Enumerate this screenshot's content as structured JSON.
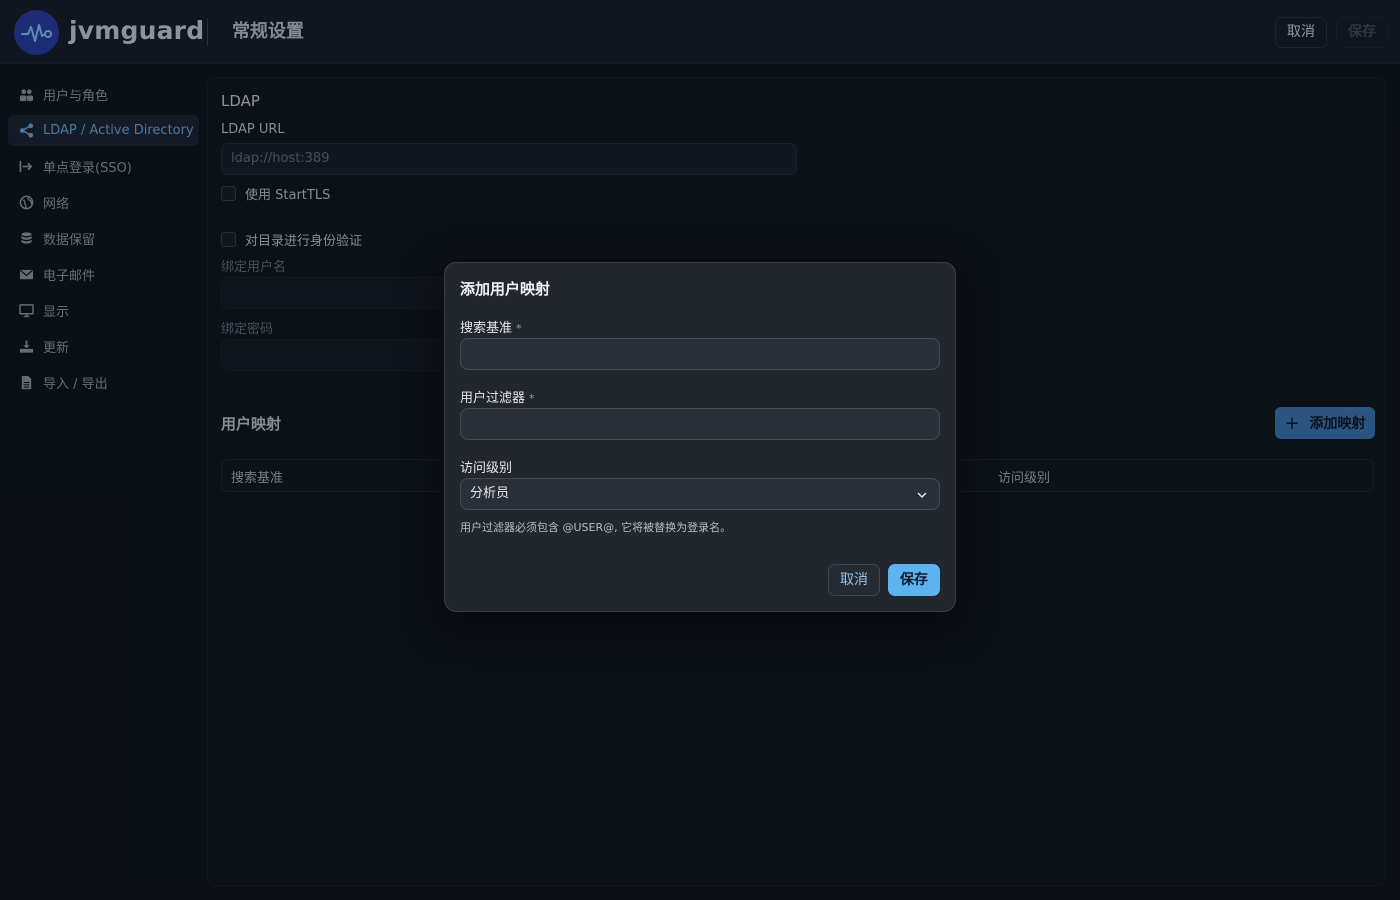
{
  "header": {
    "app_name": "jvmguard",
    "page_title": "常规设置",
    "cancel_label": "取消",
    "save_label": "保存"
  },
  "sidebar": {
    "items": [
      {
        "label": "用户与角色",
        "icon": "users-icon",
        "active": false
      },
      {
        "label": "LDAP / Active Directory",
        "icon": "share-icon",
        "active": true
      },
      {
        "label": "单点登录(SSO)",
        "icon": "sign-in-icon",
        "active": false
      },
      {
        "label": "网络",
        "icon": "globe-icon",
        "active": false
      },
      {
        "label": "数据保留",
        "icon": "database-icon",
        "active": false
      },
      {
        "label": "电子邮件",
        "icon": "envelope-icon",
        "active": false
      },
      {
        "label": "显示",
        "icon": "monitor-icon",
        "active": false
      },
      {
        "label": "更新",
        "icon": "download-icon",
        "active": false
      },
      {
        "label": "导入 / 导出",
        "icon": "file-icon",
        "active": false
      }
    ]
  },
  "ldap": {
    "section_title": "LDAP",
    "url_label": "LDAP URL",
    "url_placeholder": "ldap://host:389",
    "starttls_label": "使用 StartTLS",
    "auth_label": "对目录进行身份验证",
    "bind_user_label": "绑定用户名",
    "bind_password_label": "绑定密码"
  },
  "mapping": {
    "title": "用户映射",
    "add_button_label": "添加映射",
    "columns": [
      "搜索基准",
      "访问级别"
    ]
  },
  "modal": {
    "title": "添加用户映射",
    "search_base_label": "搜索基准",
    "user_filter_label": "用户过滤器",
    "required_mark": "*",
    "access_level_label": "访问级别",
    "access_level_value": "分析员",
    "hint": "用户过滤器必须包含 @USER@, 它将被替换为登录名。",
    "cancel_label": "取消",
    "save_label": "保存"
  },
  "colors": {
    "accent": "#5cb3f0",
    "active_nav_text": "#6fb4ee",
    "add_button_bg": "#3f7fbf",
    "logo_bg": "#2a3fae"
  }
}
